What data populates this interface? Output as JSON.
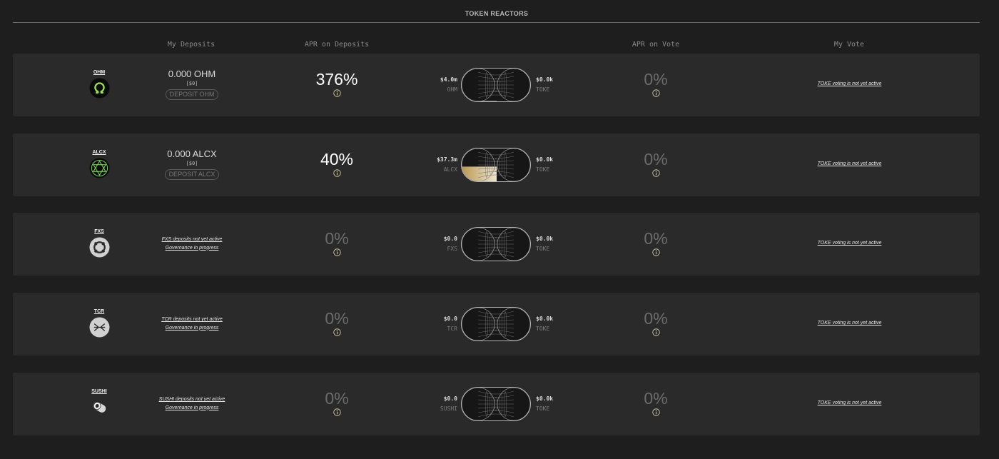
{
  "section_title": "TOKEN REACTORS",
  "columns": {
    "deposits": "My Deposits",
    "apr_deposits": "APR on Deposits",
    "apr_vote": "APR on Vote",
    "my_vote": "My Vote"
  },
  "colors": {
    "background": "#1e1e1e",
    "row_background": "#2a2a2a",
    "accent_green": "#9ee34a",
    "reactor_fill_gold": "#c9a45a"
  },
  "rows": [
    {
      "token": "OHM",
      "icon": "omega-icon",
      "deposit_amount": "0.000 OHM",
      "deposit_usd": "[$0]",
      "deposit_button": "DEPOSIT OHM",
      "apr_deposits": "376%",
      "reactor_left_value": "$4.0m",
      "reactor_left_symbol": "OHM",
      "reactor_right_value": "$0.0k",
      "reactor_right_symbol": "TOKE",
      "reactor_fill_fraction": 0.03,
      "apr_vote": "0%",
      "vote_note": "TOKE voting is not yet active"
    },
    {
      "token": "ALCX",
      "icon": "alchemix-icon",
      "deposit_amount": "0.000 ALCX",
      "deposit_usd": "[$0]",
      "deposit_button": "DEPOSIT ALCX",
      "apr_deposits": "40%",
      "reactor_left_value": "$37.3m",
      "reactor_left_symbol": "ALCX",
      "reactor_right_value": "$0.0k",
      "reactor_right_symbol": "TOKE",
      "reactor_fill_fraction": 0.45,
      "apr_vote": "0%",
      "vote_note": "TOKE voting is not yet active"
    },
    {
      "token": "FXS",
      "icon": "frax-icon",
      "deposit_note_1": "FXS deposits not yet active",
      "deposit_note_2": "Governance in progress",
      "apr_deposits": "0%",
      "reactor_left_value": "$0.0",
      "reactor_left_symbol": "FXS",
      "reactor_right_value": "$0.0k",
      "reactor_right_symbol": "TOKE",
      "reactor_fill_fraction": 0,
      "apr_vote": "0%",
      "vote_note": "TOKE voting is not yet active"
    },
    {
      "token": "TCR",
      "icon": "tracer-icon",
      "deposit_note_1": "TCR deposits not yet active",
      "deposit_note_2": "Governance in progress",
      "apr_deposits": "0%",
      "reactor_left_value": "$0.0",
      "reactor_left_symbol": "TCR",
      "reactor_right_value": "$0.0k",
      "reactor_right_symbol": "TOKE",
      "reactor_fill_fraction": 0,
      "apr_vote": "0%",
      "vote_note": "TOKE voting is not yet active"
    },
    {
      "token": "SUSHI",
      "icon": "sushi-icon",
      "deposit_note_1": "SUSHI deposits not yet active",
      "deposit_note_2": "Governance in progress",
      "apr_deposits": "0%",
      "reactor_left_value": "$0.0",
      "reactor_left_symbol": "SUSHI",
      "reactor_right_value": "$0.0k",
      "reactor_right_symbol": "TOKE",
      "reactor_fill_fraction": 0,
      "apr_vote": "0%",
      "vote_note": "TOKE voting is not yet active"
    }
  ]
}
